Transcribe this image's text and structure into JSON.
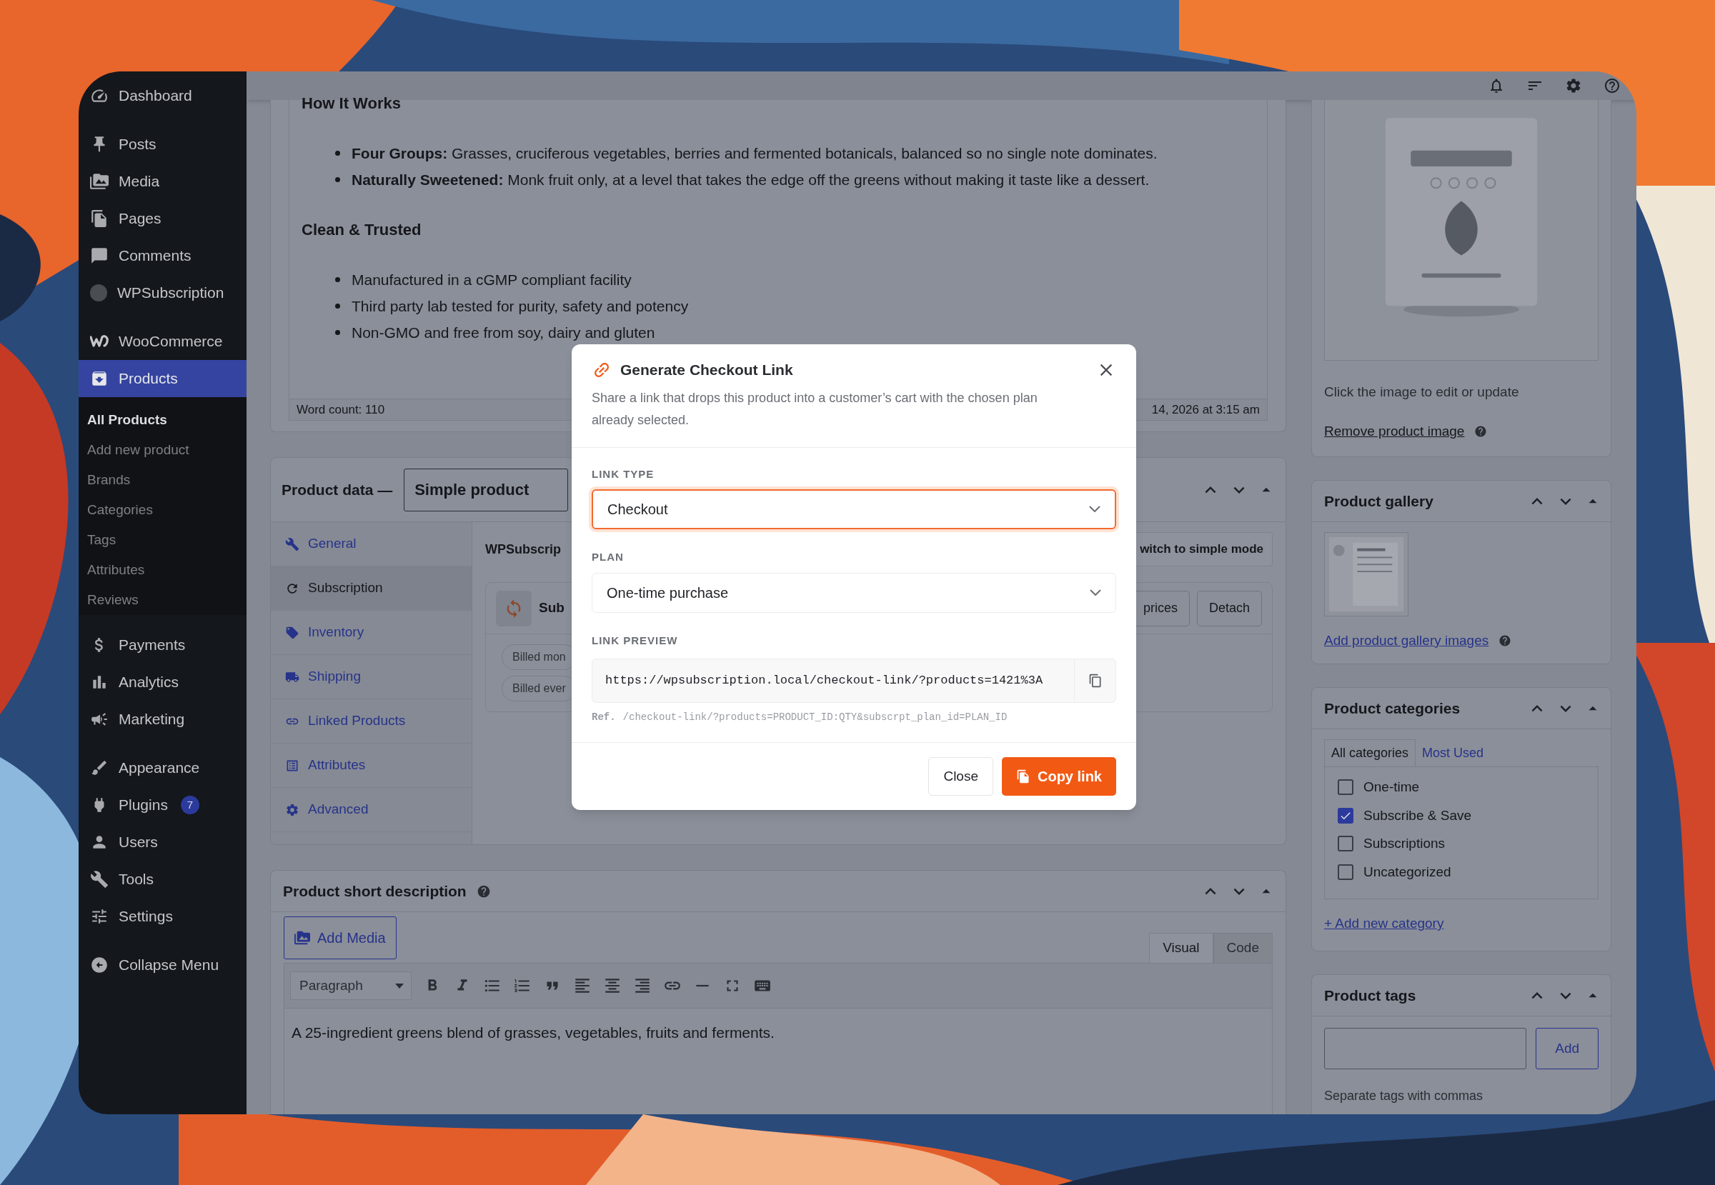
{
  "sidebar": {
    "groups": [
      {
        "items": [
          {
            "label": "Dashboard",
            "selected": false
          }
        ]
      },
      {
        "items": [
          {
            "label": "Posts",
            "selected": false
          },
          {
            "label": "Media",
            "selected": false
          },
          {
            "label": "Pages",
            "selected": false
          },
          {
            "label": "Comments",
            "selected": false
          },
          {
            "label": "WPSubscription",
            "selected": false
          }
        ]
      },
      {
        "items": [
          {
            "label": "WooCommerce",
            "selected": false
          },
          {
            "label": "Products",
            "selected": true,
            "children": [
              {
                "label": "All Products",
                "selected": true
              },
              {
                "label": "Add new product",
                "selected": false
              },
              {
                "label": "Brands",
                "selected": false
              },
              {
                "label": "Categories",
                "selected": false
              },
              {
                "label": "Tags",
                "selected": false
              },
              {
                "label": "Attributes",
                "selected": false
              },
              {
                "label": "Reviews",
                "selected": false
              }
            ]
          }
        ]
      },
      {
        "items": [
          {
            "label": "Payments",
            "selected": false
          },
          {
            "label": "Analytics",
            "selected": false
          },
          {
            "label": "Marketing",
            "selected": false
          }
        ]
      },
      {
        "items": [
          {
            "label": "Appearance",
            "selected": false
          },
          {
            "label": "Plugins",
            "selected": false,
            "badge": "7"
          },
          {
            "label": "Users",
            "selected": false
          },
          {
            "label": "Tools",
            "selected": false
          },
          {
            "label": "Settings",
            "selected": false
          }
        ]
      },
      {
        "items": [
          {
            "label": "Collapse Menu",
            "selected": false
          }
        ]
      }
    ]
  },
  "description_editor": {
    "blocks": [
      {
        "kind": "heading",
        "text": "How It Works"
      },
      {
        "kind": "list",
        "items": [
          "**Four Groups:** Grasses, cruciferous vegetables, berries and fermented botanicals, balanced so no single note dominates.",
          "**Naturally Sweetened:** Monk fruit only, at a level that takes the edge off the greens without making it taste like a dessert."
        ]
      },
      {
        "kind": "heading",
        "text": "Clean & Trusted"
      },
      {
        "kind": "list",
        "items": [
          "Manufactured in a cGMP compliant facility",
          "Third party lab tested for purity, safety and potency",
          "Non-GMO and free from soy, dairy and gluten"
        ]
      }
    ],
    "word_count": "Word count: 110",
    "last_edited": "14, 2026 at 3:15 am"
  },
  "product_data": {
    "title": "Product data —",
    "product_type": "Simple product",
    "tabs": [
      {
        "label": "General",
        "selected": false
      },
      {
        "label": "Subscription",
        "selected": true
      },
      {
        "label": "Inventory",
        "selected": false
      },
      {
        "label": "Shipping",
        "selected": false
      },
      {
        "label": "Linked Products",
        "selected": false
      },
      {
        "label": "Attributes",
        "selected": false
      },
      {
        "label": "Advanced",
        "selected": false
      }
    ],
    "panel": {
      "heading": "WPSubscrip",
      "mode_button": "witch to simple mode",
      "card_title": "Sub",
      "buttons": [
        "prices",
        "Detach"
      ],
      "pills": [
        "Billed mon",
        "Billed ever"
      ]
    }
  },
  "short_description": {
    "title": "Product short description",
    "add_media": "Add Media",
    "editor_tabs": [
      {
        "label": "Visual",
        "selected": true
      },
      {
        "label": "Code",
        "selected": false
      }
    ],
    "format": "Paragraph",
    "text": "A 25-ingredient greens blend of grasses, vegetables, fruits and ferments."
  },
  "product_image": {
    "hint": "Click the image to edit or update",
    "remove_link": "Remove product image"
  },
  "product_gallery": {
    "title": "Product gallery",
    "add_link": "Add product gallery images"
  },
  "product_categories": {
    "title": "Product categories",
    "tabs": [
      {
        "label": "All categories",
        "selected": true
      },
      {
        "label": "Most Used",
        "selected": false
      }
    ],
    "categories": [
      {
        "label": "One-time",
        "checked": false
      },
      {
        "label": "Subscribe & Save",
        "checked": true
      },
      {
        "label": "Subscriptions",
        "checked": false
      },
      {
        "label": "Uncategorized",
        "checked": false
      }
    ],
    "add_link": "+ Add new category"
  },
  "product_tags": {
    "title": "Product tags",
    "add_button": "Add",
    "hint": "Separate tags with commas"
  },
  "modal": {
    "title": "Generate Checkout Link",
    "description": "Share a link that drops this product into a customer’s cart with the chosen plan already selected.",
    "fields": [
      {
        "label": "LINK TYPE",
        "value": "Checkout",
        "focused": true
      },
      {
        "label": "PLAN",
        "value": "One-time purchase",
        "focused": false
      }
    ],
    "preview_label": "LINK PREVIEW",
    "preview_url": "https://wpsubscription.local/checkout-link/?products=1421%3A",
    "ref_label": "Ref.",
    "ref_path": "/checkout-link/?products=PRODUCT_ID:QTY&subscrpt_plan_id=PLAN_ID",
    "buttons": [
      {
        "label": "Close",
        "kind": "secondary"
      },
      {
        "label": "Copy link",
        "kind": "primary"
      }
    ]
  }
}
